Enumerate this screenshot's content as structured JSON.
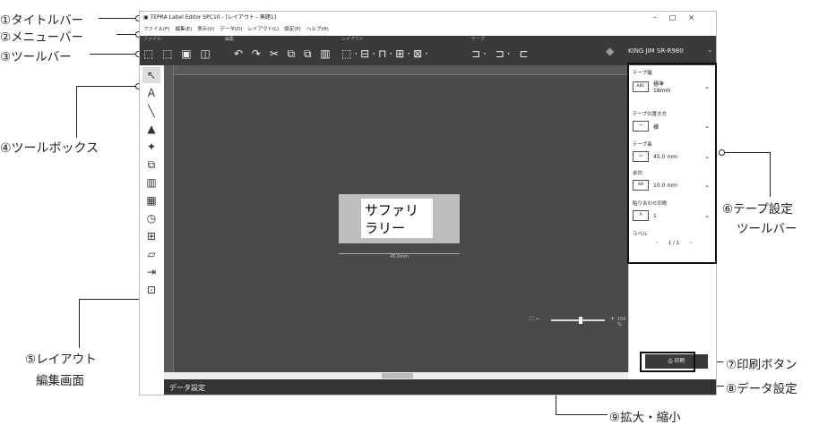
{
  "annotations": {
    "a1": "①タイトルバー",
    "a2": "②メニューバー",
    "a3": "③ツールバー",
    "a4": "④ツールボックス",
    "a5a": "⑤レイアウト",
    "a5b": "編集画面",
    "a6a": "⑥テープ設定",
    "a6b": "ツールバー",
    "a7": "⑦印刷ボタン",
    "a8": "⑧データ設定",
    "a9": "⑨拡大・縮小"
  },
  "app": {
    "title": "TEPRA Label Editor SPC10 - [レイアウト - 無題1]",
    "window_controls": [
      "–",
      "□",
      "×"
    ],
    "menu": [
      "ファイル(F)",
      "編集(E)",
      "表示(V)",
      "データ(D)",
      "レイアウト(L)",
      "設定(P)",
      "ヘルプ(H)"
    ],
    "toolbar_groups": [
      "ファイル",
      "編集",
      "レイアウト",
      "テープ"
    ],
    "printer": "KING JIM SR-R980",
    "label_text": "サファリ\nラリー",
    "label_width": "45.0mm",
    "zoom_text": "150 %",
    "panel": {
      "tape_width_title": "テープ幅",
      "tape_width_icon": "ABC",
      "tape_width_value": "標準\n18mm",
      "tape_orient_title": "テープの置き方",
      "tape_orient_value": "横",
      "tape_length_title": "テープ長",
      "tape_length_value": "45.0 mm",
      "margin_title": "余白",
      "margin_value": "10.0 mm",
      "paste_print_title": "貼り合わせ印刷",
      "paste_print_value": "1",
      "label_title": "ラベル",
      "page": "1 / 1"
    },
    "print_label": "印刷",
    "data_setting": "データ設定"
  }
}
